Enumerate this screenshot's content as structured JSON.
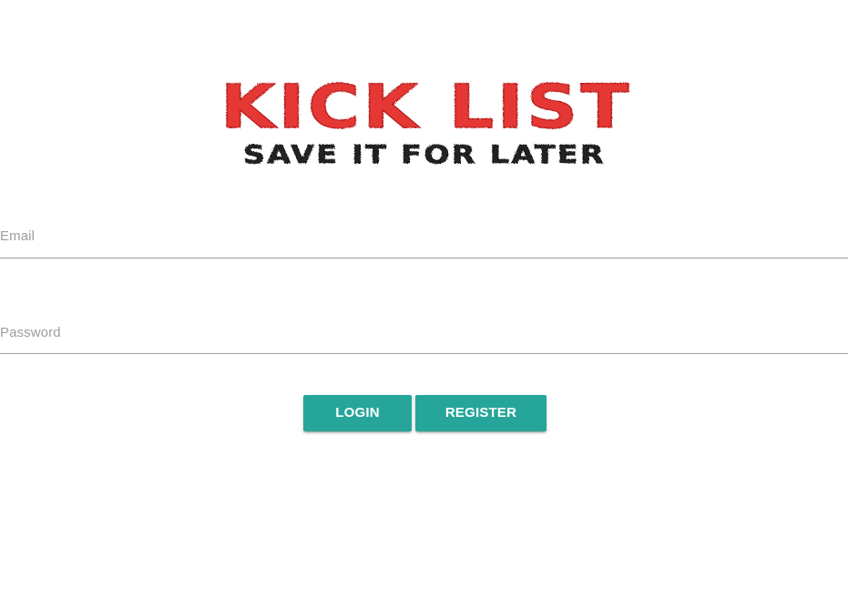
{
  "logo": {
    "title": "KICK LIST",
    "tagline": "SAVE IT FOR LATER",
    "title_color": "#e53935",
    "tagline_color": "#222222"
  },
  "form": {
    "email_label": "Email",
    "password_label": "Password",
    "email_value": "",
    "password_value": ""
  },
  "buttons": {
    "login_label": "LOGIN",
    "register_label": "REGISTER",
    "accent_color": "#26a69a"
  }
}
